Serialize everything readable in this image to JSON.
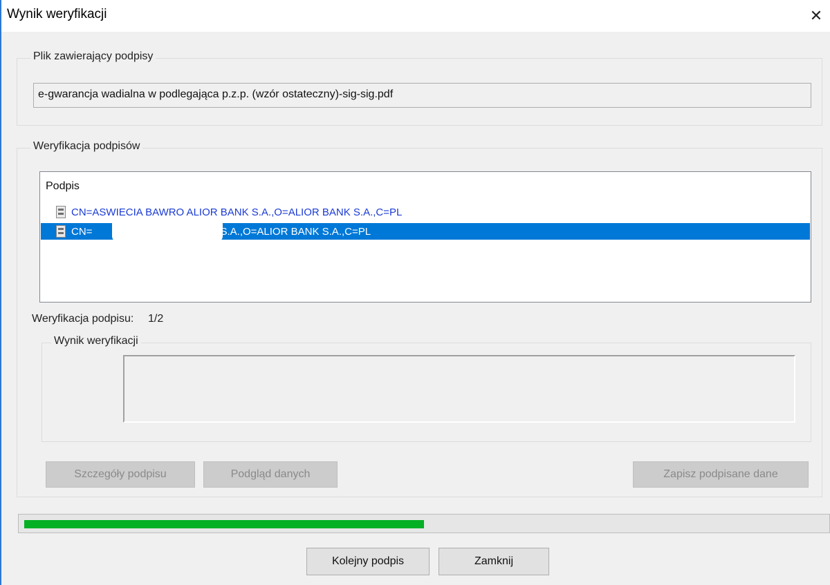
{
  "window": {
    "title": "Wynik weryfikacji"
  },
  "file_group": {
    "legend": "Plik zawierający podpisy",
    "filename": "e-gwarancja wadialna w podlegająca p.z.p. (wzór ostateczny)-sig-sig.pdf"
  },
  "verification_group": {
    "legend": "Weryfikacja podpisów",
    "list_header": "Podpis",
    "rows": [
      {
        "text": "CN=ASWIECIA BAWRO ALIOR BANK S.A.,O=ALIOR BANK S.A.,C=PL",
        "selected": false
      },
      {
        "text": "CN=                      ALIOR BANK S.A.,O=ALIOR BANK S.A.,C=PL",
        "selected": true
      }
    ],
    "counter_label": "Weryfikacja podpisu:",
    "counter_value": "1/2",
    "result_legend": "Wynik weryfikacji",
    "result_text": ""
  },
  "buttons": {
    "details": "Szczegóły podpisu",
    "preview": "Podgląd danych",
    "save": "Zapisz podpisane dane",
    "next": "Kolejny podpis",
    "close": "Zamknij"
  },
  "progress": {
    "value": 0.5
  },
  "colors": {
    "selection": "#0078d7",
    "progress": "#06b025",
    "window_border": "#2b78d4",
    "link_text": "#1a3ad4"
  },
  "icons": {
    "close": "close-icon",
    "row": "certificate-icon"
  }
}
